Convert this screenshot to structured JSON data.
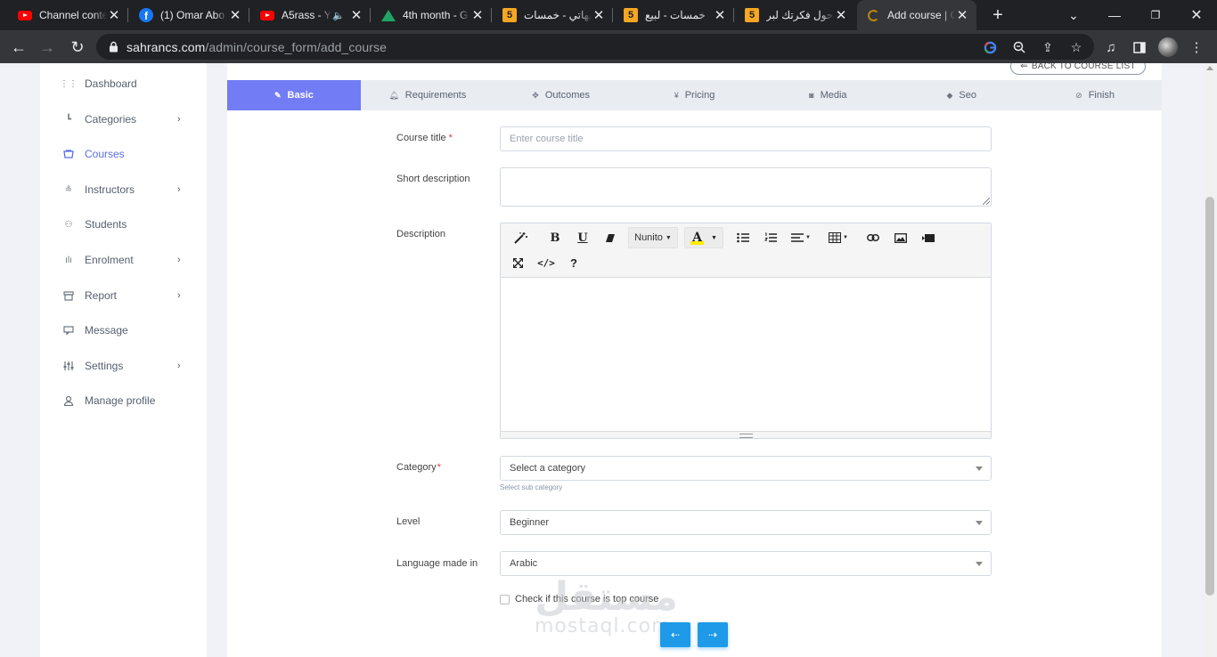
{
  "browser": {
    "tabs": [
      {
        "title": "Channel conte",
        "icon": "youtube-icon",
        "active": false
      },
      {
        "title": "(1) Omar Abo",
        "icon": "facebook-icon",
        "active": false
      },
      {
        "title": "A5rass - Y",
        "icon": "youtube-icon",
        "active": false,
        "audio": true
      },
      {
        "title": "4th month - G",
        "icon": "google-drive-icon",
        "active": false
      },
      {
        "title": "تنبيهاتي - خمسات",
        "icon": "khamsat-icon",
        "active": false
      },
      {
        "title": "خمسات - لبيع",
        "icon": "khamsat-icon",
        "active": false
      },
      {
        "title": "احول فكرتك لبر",
        "icon": "khamsat-icon",
        "active": false
      },
      {
        "title": "Add course | C",
        "icon": "loading-icon",
        "active": true
      }
    ],
    "url_host": "sahrancs.com",
    "url_path": "/admin/course_form/add_course"
  },
  "sidebar": {
    "items": [
      {
        "label": "Dashboard",
        "icon": "dashboard-icon",
        "has_submenu": false,
        "active": false
      },
      {
        "label": "Categories",
        "icon": "categories-icon",
        "has_submenu": true,
        "active": false
      },
      {
        "label": "Courses",
        "icon": "courses-icon",
        "has_submenu": false,
        "active": true
      },
      {
        "label": "Instructors",
        "icon": "instructors-icon",
        "has_submenu": true,
        "active": false
      },
      {
        "label": "Students",
        "icon": "students-icon",
        "has_submenu": false,
        "active": false
      },
      {
        "label": "Enrolment",
        "icon": "enrolment-icon",
        "has_submenu": true,
        "active": false
      },
      {
        "label": "Report",
        "icon": "report-icon",
        "has_submenu": true,
        "active": false
      },
      {
        "label": "Message",
        "icon": "message-icon",
        "has_submenu": false,
        "active": false
      },
      {
        "label": "Settings",
        "icon": "settings-icon",
        "has_submenu": true,
        "active": false
      },
      {
        "label": "Manage profile",
        "icon": "user-icon",
        "has_submenu": false,
        "active": false
      }
    ]
  },
  "main": {
    "back_button": "BACK TO COURSE LIST",
    "steps": [
      {
        "label": "Basic",
        "icon": "pencil-icon",
        "active": true
      },
      {
        "label": "Requirements",
        "icon": "bell-icon",
        "active": false
      },
      {
        "label": "Outcomes",
        "icon": "move-icon",
        "active": false
      },
      {
        "label": "Pricing",
        "icon": "yen-icon",
        "active": false
      },
      {
        "label": "Media",
        "icon": "media-icon",
        "active": false
      },
      {
        "label": "Seo",
        "icon": "tag-icon",
        "active": false
      },
      {
        "label": "Finish",
        "icon": "check-circle-icon",
        "active": false
      }
    ],
    "form": {
      "course_title_label": "Course title",
      "course_title_placeholder": "Enter course title",
      "short_description_label": "Short description",
      "description_label": "Description",
      "editor_font": "Nunito",
      "category_label": "Category",
      "category_value": "Select a category",
      "sub_category_hint": "Select sub category",
      "level_label": "Level",
      "level_value": "Beginner",
      "language_label": "Language made in",
      "language_value": "Arabic",
      "top_course_label": "Check if this course is top course",
      "required_mark": "*"
    }
  },
  "watermark": {
    "arabic": "مستقل",
    "latin": "mostaql.com"
  },
  "colors": {
    "accent": "#727cf5",
    "active_sidebar": "#5b6de8",
    "nav_button": "#1e9ae8",
    "required": "#e53935"
  }
}
